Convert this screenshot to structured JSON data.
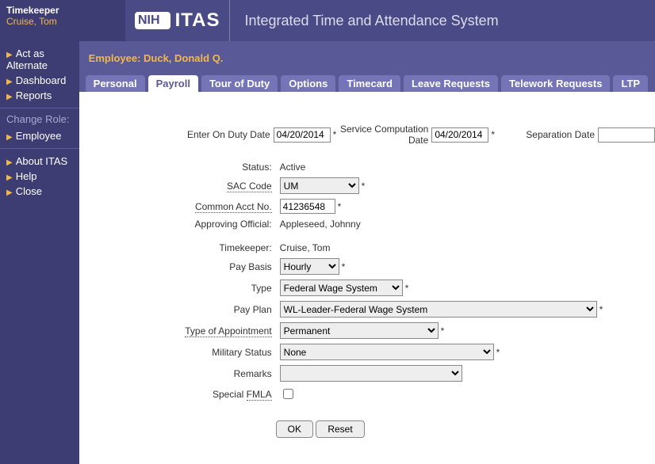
{
  "sidebar": {
    "role_label": "Timekeeper",
    "user_name": "Cruise, Tom",
    "group1": [
      {
        "label": "Act as Alternate"
      },
      {
        "label": "Dashboard"
      },
      {
        "label": "Reports"
      }
    ],
    "change_role_head": "Change Role:",
    "group2": [
      {
        "label": "Employee"
      }
    ],
    "group3": [
      {
        "label": "About ITAS"
      },
      {
        "label": "Help"
      },
      {
        "label": "Close"
      }
    ]
  },
  "header": {
    "nih": "NIH",
    "itas": "ITAS",
    "tagline": "Integrated Time and Attendance System"
  },
  "content": {
    "employee_line": "Employee: Duck, Donald Q.",
    "tabs": [
      {
        "label": "Personal"
      },
      {
        "label": "Payroll"
      },
      {
        "label": "Tour of Duty"
      },
      {
        "label": "Options"
      },
      {
        "label": "Timecard"
      },
      {
        "label": "Leave Requests"
      },
      {
        "label": "Telework Requests"
      },
      {
        "label": "LTP"
      }
    ]
  },
  "form": {
    "enter_on_duty_label": "Enter On Duty Date",
    "enter_on_duty_value": "04/20/2014",
    "svc_comp_label": "Service Computation Date",
    "svc_comp_value": "04/20/2014",
    "sep_date_label": "Separation Date",
    "sep_date_value": "",
    "status_label": "Status:",
    "status_value": "Active",
    "sac_label": "SAC Code",
    "sac_value": "UM",
    "common_acct_label": "Common Acct No.",
    "common_acct_value": "41236548",
    "approving_official_label": "Approving Official:",
    "approving_official_value": "Appleseed, Johnny",
    "timekeeper_label": "Timekeeper:",
    "timekeeper_value": "Cruise, Tom",
    "pay_basis_label": "Pay Basis",
    "pay_basis_value": "Hourly",
    "type_label": "Type",
    "type_value": "Federal Wage System",
    "pay_plan_label": "Pay Plan",
    "pay_plan_value": "WL-Leader-Federal Wage System",
    "type_appt_label": "Type of Appointment",
    "type_appt_value": "Permanent",
    "military_label": "Military Status",
    "military_value": "None",
    "remarks_label": "Remarks",
    "special_fmla_label": "Special FMLA",
    "ok": "OK",
    "reset": "Reset"
  }
}
